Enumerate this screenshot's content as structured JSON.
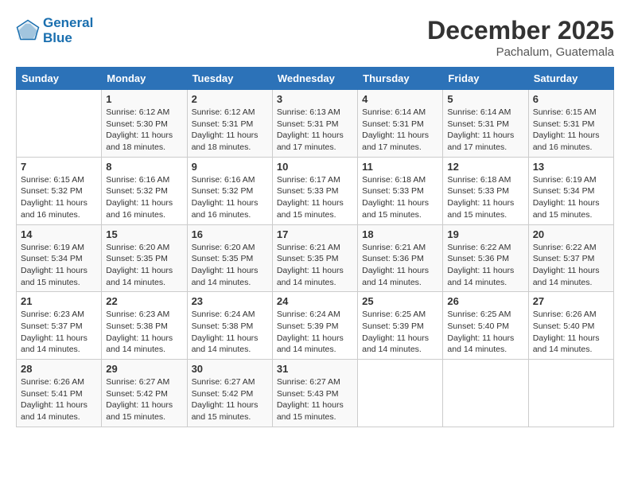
{
  "header": {
    "logo_line1": "General",
    "logo_line2": "Blue",
    "month": "December 2025",
    "location": "Pachalum, Guatemala"
  },
  "weekdays": [
    "Sunday",
    "Monday",
    "Tuesday",
    "Wednesday",
    "Thursday",
    "Friday",
    "Saturday"
  ],
  "weeks": [
    [
      {
        "day": "",
        "info": ""
      },
      {
        "day": "1",
        "info": "Sunrise: 6:12 AM\nSunset: 5:30 PM\nDaylight: 11 hours\nand 18 minutes."
      },
      {
        "day": "2",
        "info": "Sunrise: 6:12 AM\nSunset: 5:31 PM\nDaylight: 11 hours\nand 18 minutes."
      },
      {
        "day": "3",
        "info": "Sunrise: 6:13 AM\nSunset: 5:31 PM\nDaylight: 11 hours\nand 17 minutes."
      },
      {
        "day": "4",
        "info": "Sunrise: 6:14 AM\nSunset: 5:31 PM\nDaylight: 11 hours\nand 17 minutes."
      },
      {
        "day": "5",
        "info": "Sunrise: 6:14 AM\nSunset: 5:31 PM\nDaylight: 11 hours\nand 17 minutes."
      },
      {
        "day": "6",
        "info": "Sunrise: 6:15 AM\nSunset: 5:31 PM\nDaylight: 11 hours\nand 16 minutes."
      }
    ],
    [
      {
        "day": "7",
        "info": "Sunrise: 6:15 AM\nSunset: 5:32 PM\nDaylight: 11 hours\nand 16 minutes."
      },
      {
        "day": "8",
        "info": "Sunrise: 6:16 AM\nSunset: 5:32 PM\nDaylight: 11 hours\nand 16 minutes."
      },
      {
        "day": "9",
        "info": "Sunrise: 6:16 AM\nSunset: 5:32 PM\nDaylight: 11 hours\nand 16 minutes."
      },
      {
        "day": "10",
        "info": "Sunrise: 6:17 AM\nSunset: 5:33 PM\nDaylight: 11 hours\nand 15 minutes."
      },
      {
        "day": "11",
        "info": "Sunrise: 6:18 AM\nSunset: 5:33 PM\nDaylight: 11 hours\nand 15 minutes."
      },
      {
        "day": "12",
        "info": "Sunrise: 6:18 AM\nSunset: 5:33 PM\nDaylight: 11 hours\nand 15 minutes."
      },
      {
        "day": "13",
        "info": "Sunrise: 6:19 AM\nSunset: 5:34 PM\nDaylight: 11 hours\nand 15 minutes."
      }
    ],
    [
      {
        "day": "14",
        "info": "Sunrise: 6:19 AM\nSunset: 5:34 PM\nDaylight: 11 hours\nand 15 minutes."
      },
      {
        "day": "15",
        "info": "Sunrise: 6:20 AM\nSunset: 5:35 PM\nDaylight: 11 hours\nand 14 minutes."
      },
      {
        "day": "16",
        "info": "Sunrise: 6:20 AM\nSunset: 5:35 PM\nDaylight: 11 hours\nand 14 minutes."
      },
      {
        "day": "17",
        "info": "Sunrise: 6:21 AM\nSunset: 5:35 PM\nDaylight: 11 hours\nand 14 minutes."
      },
      {
        "day": "18",
        "info": "Sunrise: 6:21 AM\nSunset: 5:36 PM\nDaylight: 11 hours\nand 14 minutes."
      },
      {
        "day": "19",
        "info": "Sunrise: 6:22 AM\nSunset: 5:36 PM\nDaylight: 11 hours\nand 14 minutes."
      },
      {
        "day": "20",
        "info": "Sunrise: 6:22 AM\nSunset: 5:37 PM\nDaylight: 11 hours\nand 14 minutes."
      }
    ],
    [
      {
        "day": "21",
        "info": "Sunrise: 6:23 AM\nSunset: 5:37 PM\nDaylight: 11 hours\nand 14 minutes."
      },
      {
        "day": "22",
        "info": "Sunrise: 6:23 AM\nSunset: 5:38 PM\nDaylight: 11 hours\nand 14 minutes."
      },
      {
        "day": "23",
        "info": "Sunrise: 6:24 AM\nSunset: 5:38 PM\nDaylight: 11 hours\nand 14 minutes."
      },
      {
        "day": "24",
        "info": "Sunrise: 6:24 AM\nSunset: 5:39 PM\nDaylight: 11 hours\nand 14 minutes."
      },
      {
        "day": "25",
        "info": "Sunrise: 6:25 AM\nSunset: 5:39 PM\nDaylight: 11 hours\nand 14 minutes."
      },
      {
        "day": "26",
        "info": "Sunrise: 6:25 AM\nSunset: 5:40 PM\nDaylight: 11 hours\nand 14 minutes."
      },
      {
        "day": "27",
        "info": "Sunrise: 6:26 AM\nSunset: 5:40 PM\nDaylight: 11 hours\nand 14 minutes."
      }
    ],
    [
      {
        "day": "28",
        "info": "Sunrise: 6:26 AM\nSunset: 5:41 PM\nDaylight: 11 hours\nand 14 minutes."
      },
      {
        "day": "29",
        "info": "Sunrise: 6:27 AM\nSunset: 5:42 PM\nDaylight: 11 hours\nand 15 minutes."
      },
      {
        "day": "30",
        "info": "Sunrise: 6:27 AM\nSunset: 5:42 PM\nDaylight: 11 hours\nand 15 minutes."
      },
      {
        "day": "31",
        "info": "Sunrise: 6:27 AM\nSunset: 5:43 PM\nDaylight: 11 hours\nand 15 minutes."
      },
      {
        "day": "",
        "info": ""
      },
      {
        "day": "",
        "info": ""
      },
      {
        "day": "",
        "info": ""
      }
    ]
  ]
}
